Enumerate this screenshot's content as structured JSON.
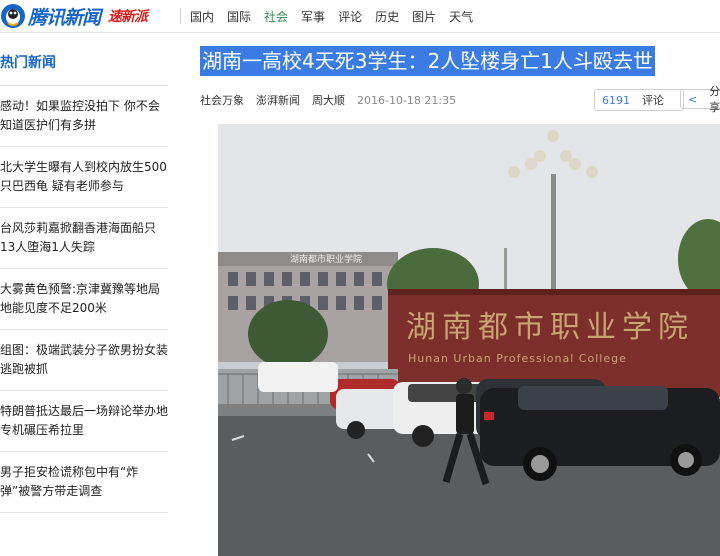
{
  "site": {
    "logo_text": "腾讯新闻",
    "channel_badge": "速新派"
  },
  "nav": {
    "items": [
      "国内",
      "国际",
      "社会",
      "军事",
      "评论",
      "历史",
      "图片",
      "天气"
    ],
    "active": "社会"
  },
  "sidebar": {
    "title": "热门新闻",
    "items": [
      "感动！如果监控没拍下 你不会知道医护们有多拼",
      "北大学生曝有人到校内放生500只巴西龟 疑有老师参与",
      "台风莎莉嘉掀翻香港海面船只 13人堕海1人失踪",
      "大雾黄色预警:京津冀豫等地局地能见度不足200米",
      "组图：极端武装分子欲男扮女装逃跑被抓",
      "特朗普抵达最后一场辩论举办地 专机碾压希拉里",
      "男子拒安检谎称包中有“炸弹”被警方带走调查"
    ]
  },
  "article": {
    "title": "湖南一高校4天死3学生：2人坠楼身亡1人斗殴去世",
    "category": "社会万象",
    "source": "澎湃新闻",
    "author": "周大顺",
    "date": "2016-10-18 21:35",
    "comment_count": "6191",
    "comment_label": "评论",
    "share_label": "分享"
  },
  "photo": {
    "building_sign": "湖南都市职业学院",
    "gate_sign": "湖南都市职业学院",
    "gate_sign_en": "Hunan Urban Professional College"
  },
  "colors": {
    "brand_blue": "#1766c5",
    "active_nav": "#2a8c4a",
    "highlight": "#3a7ce3"
  }
}
